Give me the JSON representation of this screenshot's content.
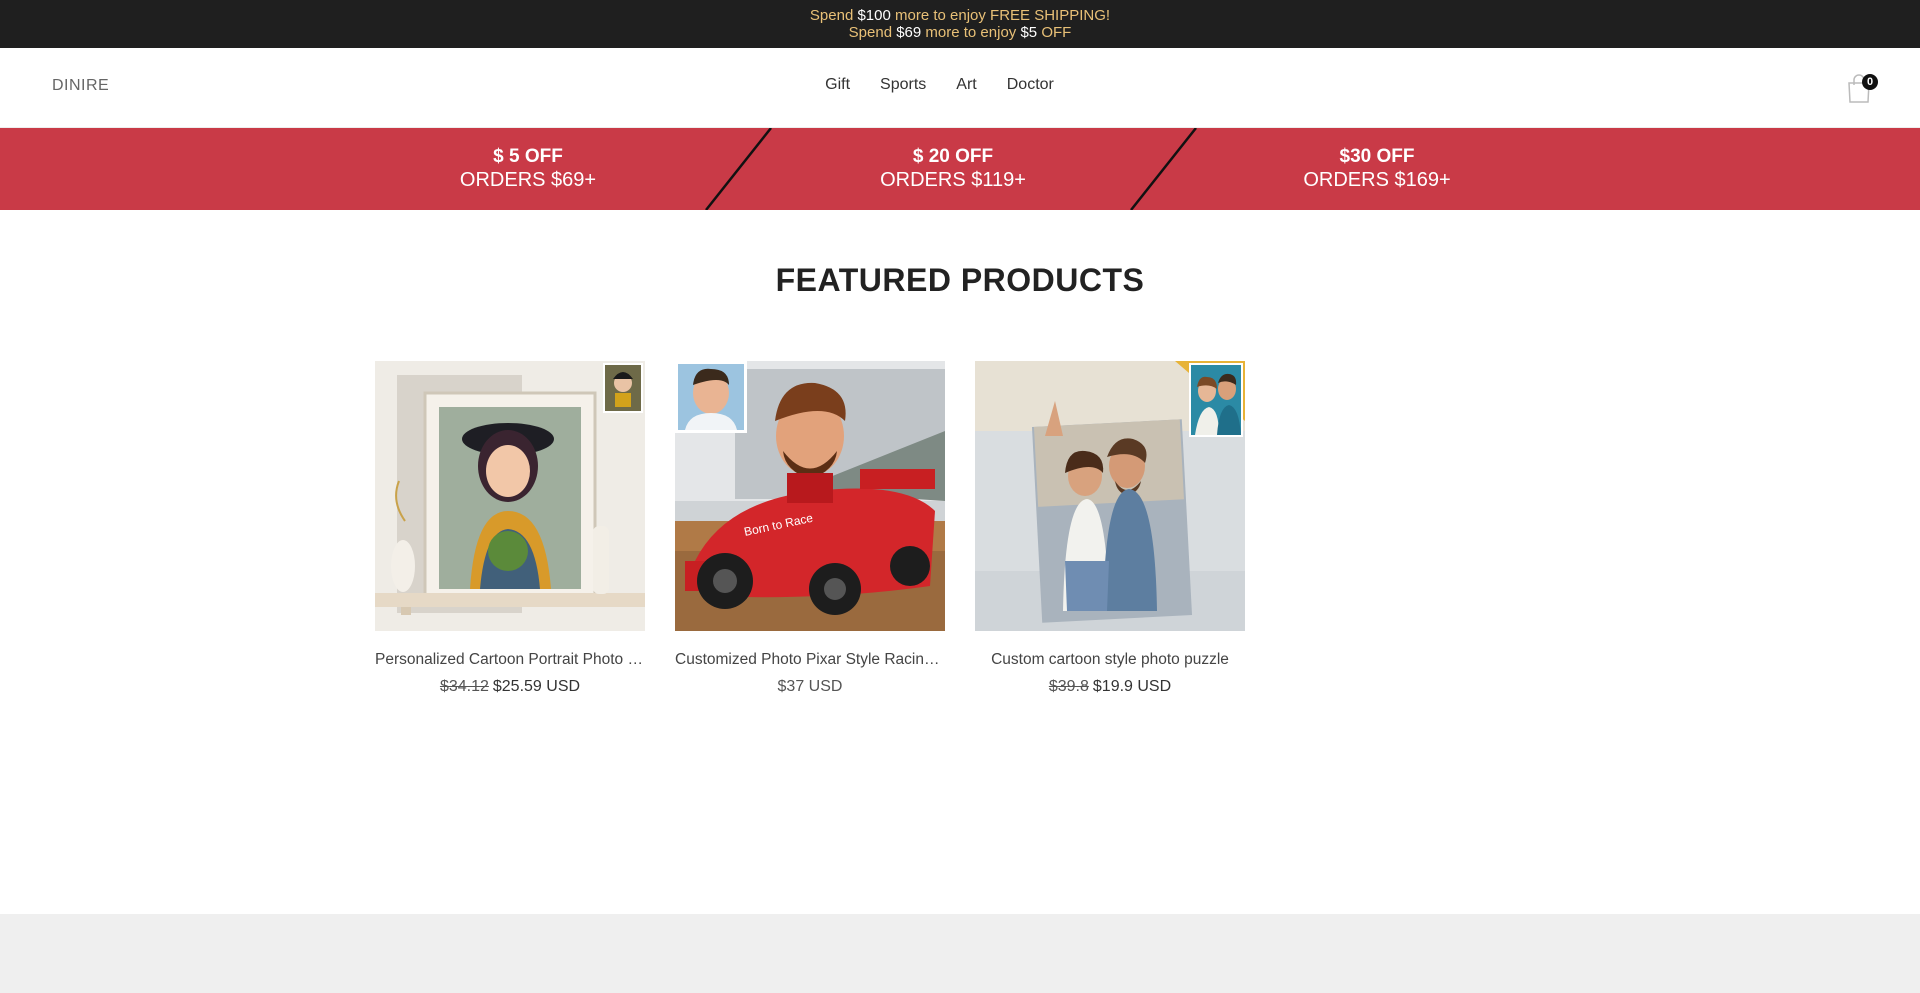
{
  "announcement": {
    "line1": {
      "pre": "Spend ",
      "amount": "$100",
      "post": " more to enjoy FREE SHIPPING!"
    },
    "line2": {
      "pre": "Spend ",
      "amount": "$69",
      "mid": " more to enjoy ",
      "amount2": "$5",
      "post": " OFF"
    }
  },
  "header": {
    "logo": "DINIRE",
    "nav": [
      "Gift",
      "Sports",
      "Art",
      "Doctor"
    ],
    "cart_count": "0"
  },
  "promo": [
    {
      "title": "$ 5 OFF",
      "subtitle": "ORDERS $69+"
    },
    {
      "title": "$ 20 OFF",
      "subtitle": "ORDERS $119+"
    },
    {
      "title": "$30 OFF",
      "subtitle": "ORDERS $169+"
    }
  ],
  "featured": {
    "title": "FEATURED PRODUCTS",
    "products": [
      {
        "name": "Personalized Cartoon Portrait Photo Frame",
        "old_price": "$34.12",
        "price": "$25.59 USD"
      },
      {
        "name": "Customized Photo Pixar Style Racing Car",
        "old_price": "",
        "price": "$37 USD"
      },
      {
        "name": "Custom cartoon style photo puzzle",
        "old_price": "$39.8",
        "price": "$19.9 USD"
      }
    ]
  },
  "colors": {
    "announce_bg": "#1f1f1f",
    "announce_text": "#e8c077",
    "promo_bg": "#c93a47",
    "footer_bg": "#efefef"
  }
}
